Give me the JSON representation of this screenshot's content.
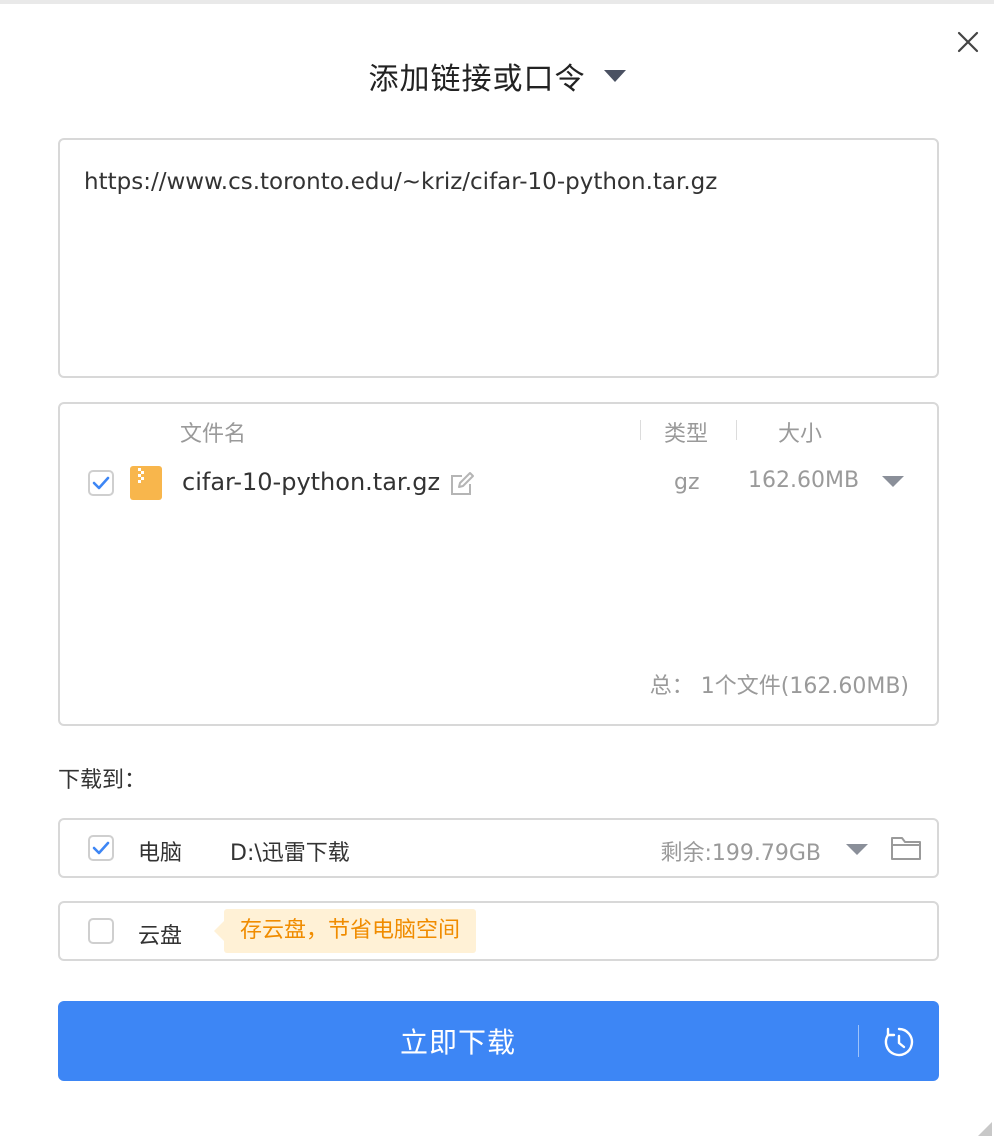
{
  "dialog": {
    "title": "添加链接或口令",
    "link_text": "https://www.cs.toronto.edu/~kriz/cifar-10-python.tar.gz"
  },
  "file_list": {
    "headers": {
      "name": "文件名",
      "type": "类型",
      "size": "大小"
    },
    "files": [
      {
        "name": "cifar-10-python.tar.gz",
        "type": "gz",
        "size": "162.60MB",
        "checked": true,
        "icon": "zip-file-icon"
      }
    ],
    "total_label": "总：",
    "total_value": "1个文件(162.60MB)"
  },
  "destination": {
    "label": "下载到：",
    "local": {
      "label": "电脑",
      "path": "D:\\迅雷下载",
      "free": "剩余:199.79GB",
      "checked": true
    },
    "cloud": {
      "label": "云盘",
      "tip": "存云盘，节省电脑空间",
      "checked": false
    }
  },
  "actions": {
    "download_now": "立即下载"
  },
  "colors": {
    "accent": "#3d86f5",
    "tip_bg": "#fff1d6",
    "tip_text": "#f08c00",
    "checkbox_check": "#3d86f5"
  }
}
